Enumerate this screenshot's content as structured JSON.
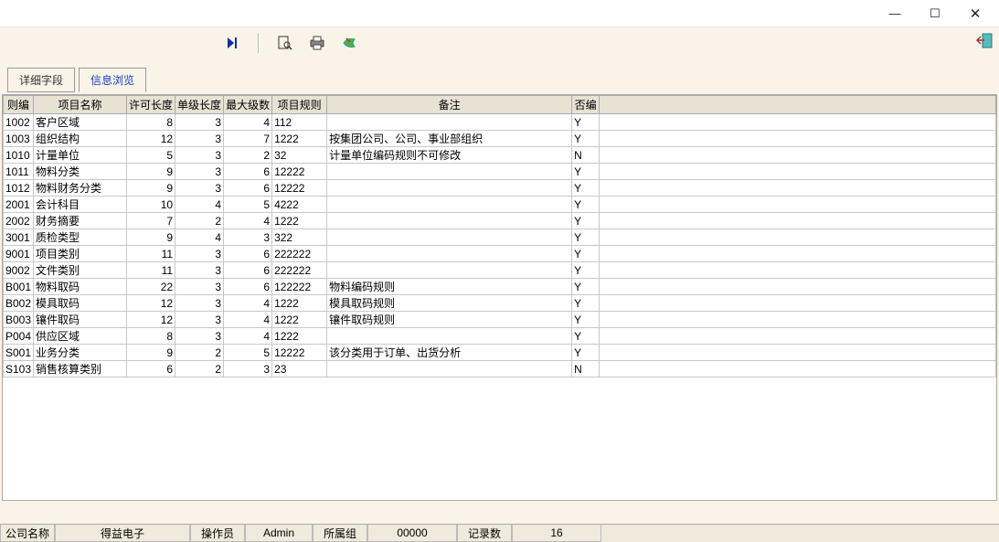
{
  "window": {
    "min": "—",
    "max": "☐",
    "close": "✕"
  },
  "tabs": {
    "detail": "详细字段",
    "browse": "信息浏览"
  },
  "columns": [
    "则编",
    "项目名称",
    "许可长度",
    "单级长度",
    "最大级数",
    "项目规则",
    "备注",
    "否编"
  ],
  "rows": [
    {
      "c0": "1002",
      "c1": "客户区域",
      "c2": "8",
      "c3": "3",
      "c4": "4",
      "c5": "112",
      "c6": "",
      "c7": "Y"
    },
    {
      "c0": "1003",
      "c1": "组织结构",
      "c2": "12",
      "c3": "3",
      "c4": "7",
      "c5": "1222",
      "c6": "按集团公司、公司、事业部组织",
      "c7": "Y"
    },
    {
      "c0": "1010",
      "c1": "计量单位",
      "c2": "5",
      "c3": "3",
      "c4": "2",
      "c5": "32",
      "c6": "计量单位编码规则不可修改",
      "c7": "N"
    },
    {
      "c0": "1011",
      "c1": "物料分类",
      "c2": "9",
      "c3": "3",
      "c4": "6",
      "c5": "12222",
      "c6": "",
      "c7": "Y"
    },
    {
      "c0": "1012",
      "c1": "物料财务分类",
      "c2": "9",
      "c3": "3",
      "c4": "6",
      "c5": "12222",
      "c6": "",
      "c7": "Y"
    },
    {
      "c0": "2001",
      "c1": "会计科目",
      "c2": "10",
      "c3": "4",
      "c4": "5",
      "c5": "4222",
      "c6": "",
      "c7": "Y"
    },
    {
      "c0": "2002",
      "c1": "财务摘要",
      "c2": "7",
      "c3": "2",
      "c4": "4",
      "c5": "1222",
      "c6": "",
      "c7": "Y"
    },
    {
      "c0": "3001",
      "c1": "质检类型",
      "c2": "9",
      "c3": "4",
      "c4": "3",
      "c5": "322",
      "c6": "",
      "c7": "Y"
    },
    {
      "c0": "9001",
      "c1": "项目类别",
      "c2": "11",
      "c3": "3",
      "c4": "6",
      "c5": "222222",
      "c6": "",
      "c7": "Y"
    },
    {
      "c0": "9002",
      "c1": "文件类别",
      "c2": "11",
      "c3": "3",
      "c4": "6",
      "c5": "222222",
      "c6": "",
      "c7": "Y"
    },
    {
      "c0": "B001",
      "c1": "物料取码",
      "c2": "22",
      "c3": "3",
      "c4": "6",
      "c5": "122222",
      "c6": "物料编码规则",
      "c7": "Y"
    },
    {
      "c0": "B002",
      "c1": "模具取码",
      "c2": "12",
      "c3": "3",
      "c4": "4",
      "c5": "1222",
      "c6": "模具取码规则",
      "c7": "Y"
    },
    {
      "c0": "B003",
      "c1": "镶件取码",
      "c2": "12",
      "c3": "3",
      "c4": "4",
      "c5": "1222",
      "c6": "镶件取码规则",
      "c7": "Y"
    },
    {
      "c0": "P004",
      "c1": "供应区域",
      "c2": "8",
      "c3": "3",
      "c4": "4",
      "c5": "1222",
      "c6": "",
      "c7": "Y"
    },
    {
      "c0": "S001",
      "c1": "业务分类",
      "c2": "9",
      "c3": "2",
      "c4": "5",
      "c5": "12222",
      "c6": "该分类用于订单、出货分析",
      "c7": "Y"
    },
    {
      "c0": "S103",
      "c1": "销售核算类别",
      "c2": "6",
      "c3": "2",
      "c4": "3",
      "c5": "23",
      "c6": "",
      "c7": "N"
    }
  ],
  "status": {
    "company_label": "公司名称",
    "company_value": "得益电子",
    "operator_label": "操作员",
    "operator_value": "Admin",
    "group_label": "所属组",
    "group_value": "00000",
    "count_label": "记录数",
    "count_value": "16"
  }
}
